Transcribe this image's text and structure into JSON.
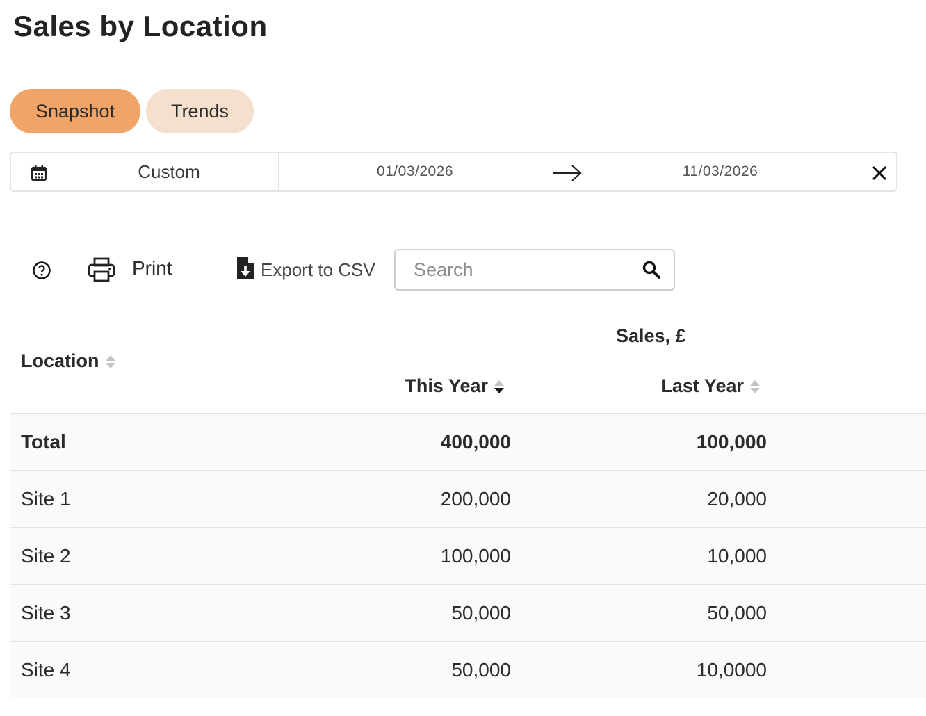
{
  "page": {
    "title": "Sales by Location"
  },
  "tabs": [
    {
      "label": "Snapshot",
      "active": true
    },
    {
      "label": "Trends",
      "active": false
    }
  ],
  "date_range": {
    "preset": "Custom",
    "start": "01/03/2026",
    "end": "11/03/2026",
    "icons": {
      "calendar": "calendar-icon",
      "arrow": "arrow-right-icon",
      "clear": "close-icon"
    }
  },
  "toolbar": {
    "help_icon": "help-circle-icon",
    "print_label": "Print",
    "export_label": "Export to CSV",
    "search_placeholder": "Search"
  },
  "table": {
    "columns": {
      "location": "Location",
      "group": "Sales, £",
      "this_year": "This Year",
      "last_year": "Last Year"
    },
    "sort": {
      "column": "this_year",
      "direction": "desc"
    },
    "rows": [
      {
        "location": "Total",
        "this_year": "400,000",
        "last_year": "100,000",
        "is_total": true
      },
      {
        "location": "Site 1",
        "this_year": "200,000",
        "last_year": "20,000"
      },
      {
        "location": "Site 2",
        "this_year": "100,000",
        "last_year": "10,000"
      },
      {
        "location": "Site 3",
        "this_year": "50,000",
        "last_year": "50,000"
      },
      {
        "location": "Site 4",
        "this_year": "50,000",
        "last_year": "10,0000"
      }
    ]
  },
  "colors": {
    "tab_active": "#f0a467",
    "tab_inactive": "#f5e0cd",
    "row_background": "#fafafa",
    "border": "#e2e2e2"
  }
}
